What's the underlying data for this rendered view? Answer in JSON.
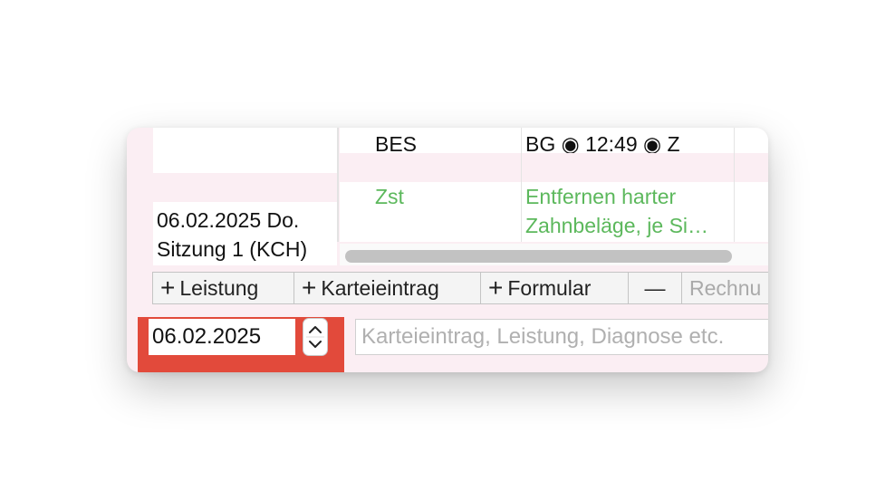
{
  "session": {
    "date_label": "06.02.2025 Do.",
    "name_label": "Sitzung 1 (KCH)"
  },
  "table": {
    "rows": [
      {
        "code": "BES",
        "description": "BG ◉ 12:49 ◉ Z",
        "code_color": "#111111"
      },
      {
        "code": "Zst",
        "description_line1": "Entfernen harter",
        "description_line2": "Zahnbeläge, je Si…",
        "code_color": "#5cb85c"
      }
    ]
  },
  "toolbar": {
    "add_leistung": "Leistung",
    "add_karteieintrag": "Karteieintrag",
    "add_formular": "Formular",
    "remove": "—",
    "rechnung": "Rechnu",
    "plus_glyph": "+"
  },
  "input_row": {
    "date_value": "06.02.2025",
    "entry_placeholder": "Karteieintrag, Leistung, Diagnose etc."
  },
  "colors": {
    "accent_red": "#e24a3b",
    "pink_bg": "#fbeef3",
    "green_text": "#5cb85c"
  }
}
